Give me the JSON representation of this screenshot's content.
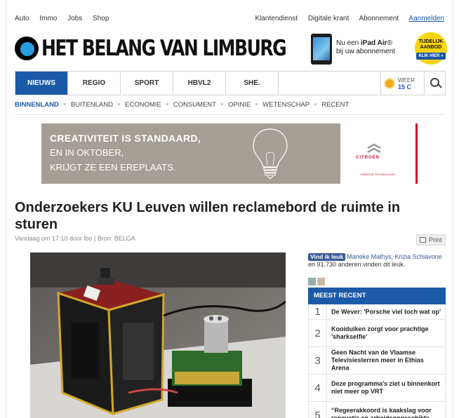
{
  "toplinks": {
    "left": [
      "Auto",
      "Immo",
      "Jobs",
      "Shop"
    ],
    "right": [
      "Klantendienst",
      "Digitale krant",
      "Abonnement",
      "Aanmelden"
    ]
  },
  "logo": {
    "text": "HET BELANG VAN LIMBURG"
  },
  "promo": {
    "line1_prefix": "Nu een ",
    "line1_bold": "iPad Air",
    "line1_suffix": "®",
    "line2": "bij uw abonnement",
    "badge_line1": "TIJDELIJK",
    "badge_line2": "AANBOD",
    "badge_cta": "KLIK HIER »"
  },
  "mainnav": {
    "tabs": [
      "NIEUWS",
      "REGIO",
      "SPORT",
      "HBVL2",
      "SHE."
    ],
    "active_index": 0,
    "weather_label": "WEER",
    "weather_temp": "15 C"
  },
  "subnav": {
    "items": [
      "BINNENLAND",
      "BUITENLAND",
      "ECONOMIE",
      "CONSUMENT",
      "OPINIE",
      "WETENSCHAP",
      "RECENT"
    ],
    "active_index": 0
  },
  "ad": {
    "line1": "CREATIVITEIT IS STANDAARD,",
    "line2": "EN IN OKTOBER,",
    "line3": "KRIJGT ZE EEN EREPLAATS.",
    "brand": "CITROËN",
    "tagline": "CRÉATIVE TECHNOLOGIE",
    "colors": {
      "background": "#a59e96",
      "brand": "#c8102e"
    }
  },
  "article": {
    "headline": "Onderzoekers KU Leuven willen reclamebord de ruimte in sturen",
    "meta": "Vandaag om 17:10 door lbo | Bron: BELGA",
    "print_label": "Print"
  },
  "sidebar": {
    "fb_button": "Vind ik leuk",
    "fb_names": "Marieke Mathys, Krizia Schiavone",
    "fb_rest": " en 91.730 anderen vinden dit leuk.",
    "most_recent_title": "MEEST RECENT",
    "most_recent": [
      {
        "num": "1",
        "title": "De Wever: 'Porsche viel toch wat op'"
      },
      {
        "num": "2",
        "title": "Kooiduiken zorgt voor prachtige 'sharkselfie'"
      },
      {
        "num": "3",
        "title": "Geen Nacht van de Vlaamse Televisiesterren meer in Ethias Arena"
      },
      {
        "num": "4",
        "title": "Deze programma's ziet u binnenkort niet meer op VRT"
      },
      {
        "num": "5",
        "title": "“Regeerakkoord is kaakslag voor renovatie en arbeidsongeschikte"
      }
    ]
  },
  "colors": {
    "accent": "#1b5aa7",
    "facebook": "#3b5998"
  }
}
